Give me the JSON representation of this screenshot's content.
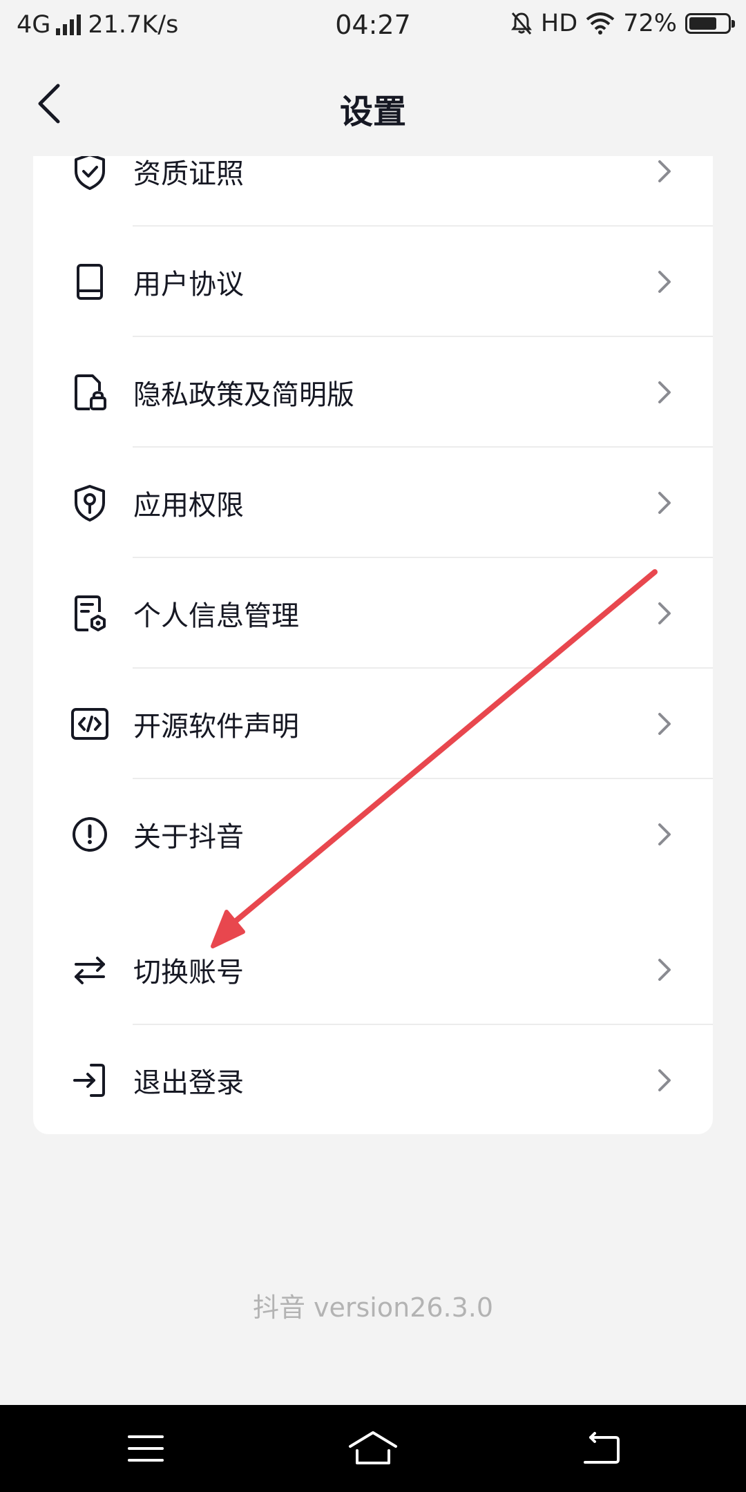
{
  "status_bar": {
    "network": "4G",
    "speed": "21.7K/s",
    "time": "04:27",
    "hd": "HD",
    "battery": "72%",
    "battery_level": 0.72
  },
  "header": {
    "title": "设置"
  },
  "settings_group_1": {
    "items": [
      {
        "label": "资质证照",
        "icon": "shield-check-icon"
      },
      {
        "label": "用户协议",
        "icon": "book-icon"
      },
      {
        "label": "隐私政策及简明版",
        "icon": "document-lock-icon"
      },
      {
        "label": "应用权限",
        "icon": "shield-key-icon"
      },
      {
        "label": "个人信息管理",
        "icon": "document-gear-icon"
      },
      {
        "label": "开源软件声明",
        "icon": "code-icon"
      },
      {
        "label": "关于抖音",
        "icon": "info-icon"
      }
    ]
  },
  "settings_group_2": {
    "items": [
      {
        "label": "切换账号",
        "icon": "switch-arrows-icon"
      },
      {
        "label": "退出登录",
        "icon": "logout-icon"
      }
    ]
  },
  "footer": {
    "version": "抖音 version26.3.0"
  },
  "colors": {
    "background": "#f3f3f3",
    "card": "#ffffff",
    "text": "#161823",
    "chevron": "#8a8b91",
    "version_text": "#b3b3b3",
    "annotation_arrow": "#e8474e"
  }
}
